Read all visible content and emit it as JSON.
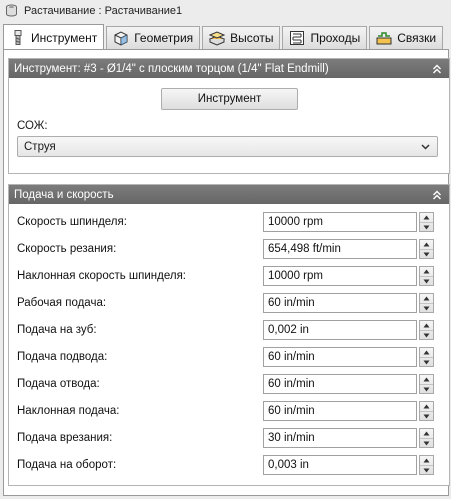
{
  "window": {
    "title": "Растачивание : Растачивание1"
  },
  "tabs": [
    {
      "label": "Инструмент",
      "icon": "tool-icon",
      "active": true
    },
    {
      "label": "Геометрия",
      "icon": "geometry-cube-icon",
      "active": false
    },
    {
      "label": "Высоты",
      "icon": "heights-icon",
      "active": false
    },
    {
      "label": "Проходы",
      "icon": "passes-icon",
      "active": false
    },
    {
      "label": "Связки",
      "icon": "linking-icon",
      "active": false
    }
  ],
  "tool_group": {
    "header": "Инструмент: #3 - Ø1/4\" с плоским торцом (1/4\" Flat Endmill)",
    "tool_button": "Инструмент",
    "coolant_label": "СОЖ:",
    "coolant_value": "Струя"
  },
  "feed_group": {
    "header": "Подача и скорость",
    "rows": [
      {
        "label": "Скорость шпинделя:",
        "value": "10000 rpm"
      },
      {
        "label": "Скорость резания:",
        "value": "654,498 ft/min"
      },
      {
        "label": "Наклонная скорость шпинделя:",
        "value": "10000 rpm"
      },
      {
        "label": "Рабочая подача:",
        "value": "60 in/min"
      },
      {
        "label": "Подача на зуб:",
        "value": "0,002 in"
      },
      {
        "label": "Подача подвода:",
        "value": "60 in/min"
      },
      {
        "label": "Подача отвода:",
        "value": "60 in/min"
      },
      {
        "label": "Наклонная подача:",
        "value": "60 in/min"
      },
      {
        "label": "Подача врезания:",
        "value": "30 in/min"
      },
      {
        "label": "Подача на оборот:",
        "value": "0,003 in"
      }
    ]
  },
  "colors": {
    "group_header": "#707070",
    "panel": "#ffffff",
    "background": "#ececec"
  }
}
